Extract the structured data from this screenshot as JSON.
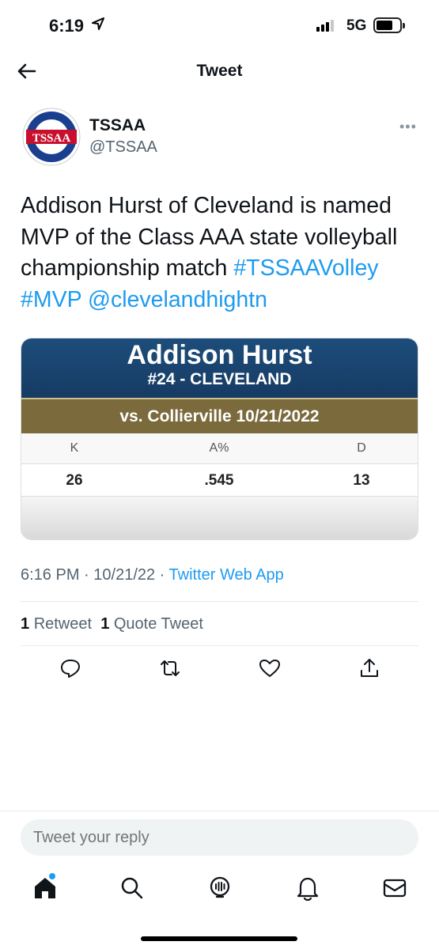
{
  "status_bar": {
    "time": "6:19",
    "network": "5G"
  },
  "header": {
    "title": "Tweet"
  },
  "author": {
    "name": "TSSAA",
    "handle": "@TSSAA",
    "avatar_text": "TSSAA"
  },
  "tweet": {
    "text_plain": "Addison Hurst of Cleveland is named MVP of the Class AAA state volleyball championship match",
    "hashtag1": "#TSSAAVolley",
    "hashtag2": "#MVP",
    "mention": "@clevelandhightn"
  },
  "card": {
    "player_name": "Addison Hurst",
    "player_number": "#24 - CLEVELAND",
    "match": "vs. Collierville 10/21/2022",
    "stat_headers": [
      "K",
      "A%",
      "D"
    ],
    "stat_values": [
      "26",
      ".545",
      "13"
    ]
  },
  "meta": {
    "time": "6:16 PM",
    "date": "10/21/22",
    "source": "Twitter Web App"
  },
  "counts": {
    "retweets": "1",
    "retweets_label": "Retweet",
    "quotes": "1",
    "quotes_label": "Quote Tweet"
  },
  "reply": {
    "placeholder": "Tweet your reply"
  },
  "colors": {
    "accent": "#1d9bf0",
    "card_blue": "#1d4d7b",
    "card_gold": "#7a6a3c"
  }
}
